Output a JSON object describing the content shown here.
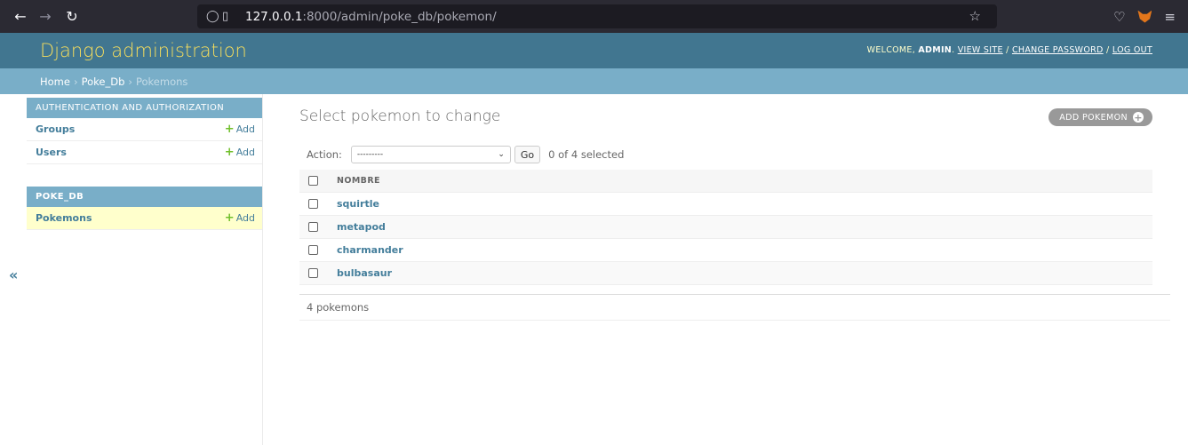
{
  "browser": {
    "url_host": "127.0.0.1",
    "url_path": ":8000/admin/poke_db/pokemon/"
  },
  "header": {
    "branding": "Django administration",
    "welcome": "WELCOME,",
    "username": "ADMIN",
    "view_site": "VIEW SITE",
    "change_password": "CHANGE PASSWORD",
    "log_out": "LOG OUT",
    "sep": "/"
  },
  "breadcrumbs": {
    "home": "Home",
    "app": "Poke_Db",
    "current": "Pokemons",
    "sep": "›"
  },
  "sidebar": {
    "auth_caption": "AUTHENTICATION AND AUTHORIZATION",
    "auth_items": [
      {
        "label": "Groups",
        "add": "Add"
      },
      {
        "label": "Users",
        "add": "Add"
      }
    ],
    "poke_caption": "POKE_DB",
    "poke_items": [
      {
        "label": "Pokemons",
        "add": "Add"
      }
    ],
    "toggle": "«"
  },
  "content": {
    "title": "Select pokemon to change",
    "add_button": "ADD POKEMON",
    "action_label": "Action:",
    "action_select": "---------",
    "go_label": "Go",
    "selected_count": "0 of 4 selected",
    "column_header": "NOMBRE",
    "rows": [
      "squirtle",
      "metapod",
      "charmander",
      "bulbasaur"
    ],
    "paginator": "4 pokemons"
  },
  "colors": {
    "header_bg": "#417690",
    "branding": "#f5dd5d",
    "caption_bg": "#79aec8",
    "link": "#447e9b",
    "add_green": "#70bf2b"
  }
}
